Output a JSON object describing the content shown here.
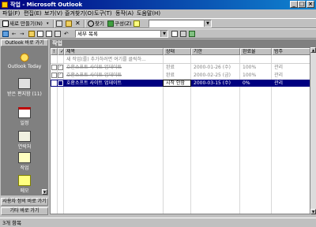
{
  "window": {
    "title": "작업 - Microsoft Outlook"
  },
  "menu": [
    "파일(F)",
    "편집(E)",
    "보기(V)",
    "즐겨찾기(O)",
    "도구(T)",
    "동작(A)",
    "도움말(H)"
  ],
  "toolbar1": {
    "new_label": "새로 만들기(N)",
    "find_label": "찾기",
    "organize_label": "구성(Z)"
  },
  "toolbar2": {
    "view_combo": "세부 목록"
  },
  "outlook_bar": {
    "header": "Outlook 바로 가기",
    "items": [
      "Outlook Today",
      "받은 편지함 (11)",
      "일정",
      "연락처",
      "작업",
      "메모"
    ],
    "my_shortcuts": "사용자 정의 바로 가기",
    "other_shortcuts": "기타 바로 가기"
  },
  "folder": {
    "title": "작업"
  },
  "grid": {
    "columns": [
      "제목",
      "상태",
      "기한",
      "완료율",
      "범주"
    ],
    "new_item_prompt": "새 작업(를) 추가하려면 여기를 클릭하...",
    "rows": [
      {
        "subject": "호환소프트 사이트 업데이트",
        "status": "완료",
        "due": "2000-01-26 (수)",
        "pct": "100%",
        "category": "관리"
      },
      {
        "subject": "호환소프트 사이트 업데이트",
        "status": "완료",
        "due": "2000-02-25 (금)",
        "pct": "100%",
        "category": "관리"
      },
      {
        "subject": "호환소프트 사이트 업데이트",
        "status": "시작 안함",
        "due": "2000-03-15 (수)",
        "pct": "0%",
        "category": "관리"
      }
    ]
  },
  "status": {
    "text": "3개 항목"
  },
  "colors": {
    "selection": "#000080",
    "title_bar": "#000080",
    "pane": "#808080"
  }
}
